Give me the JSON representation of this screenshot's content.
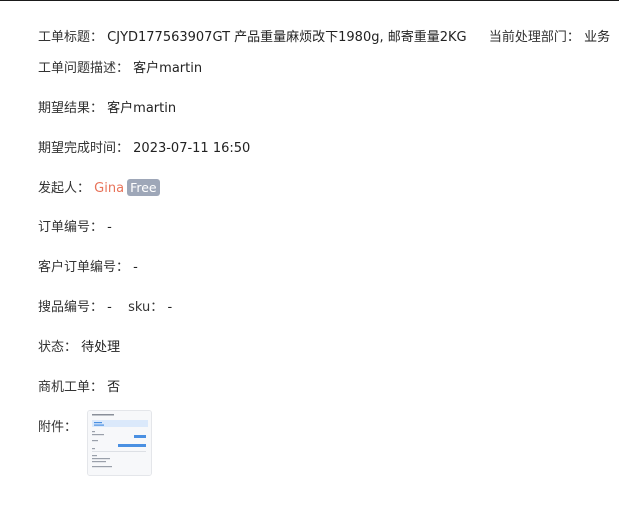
{
  "ticket": {
    "title_label": "工单标题：",
    "title_value": "CJYD177563907GT  产品重量麻烦改下1980g, 邮寄重量2KG",
    "dept_label": "当前处理部门：",
    "dept_value": "业务",
    "issue_label": "工单问题描述：",
    "issue_value": "客户martin",
    "expected_label": "期望结果：",
    "expected_value": "客户martin",
    "due_label": "期望完成时间：",
    "due_value": "2023-07-11 16:50",
    "initiator_label": "发起人：",
    "initiator_name": "Gina",
    "initiator_tag": "Free",
    "order_label": "订单编号：",
    "order_value": "-",
    "customer_order_label": "客户订单编号：",
    "customer_order_value": "-",
    "product_label": "搜品编号：",
    "product_value": "-",
    "sku_label": "sku：",
    "sku_value": "-",
    "status_label": "状态：",
    "status_value": "待处理",
    "opportunity_label": "商机工单：",
    "opportunity_value": "否",
    "attachment_label": "附件："
  },
  "colors": {
    "initiator_name": "#e8735a",
    "tag_bg": "#9ea7b8",
    "thumb_accent": "#4a90e2"
  }
}
